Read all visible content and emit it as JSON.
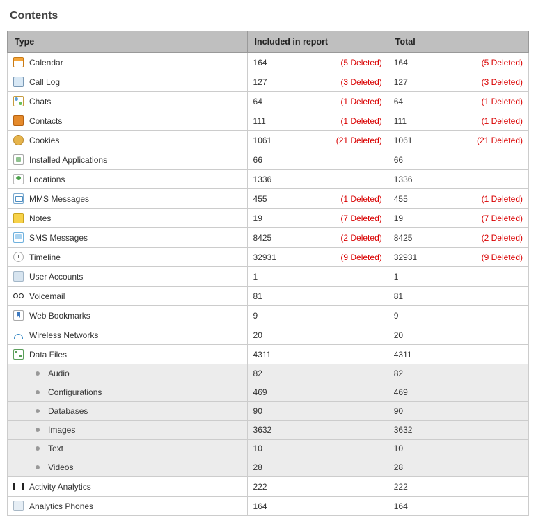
{
  "section_title": "Contents",
  "columns": {
    "type": "Type",
    "included": "Included in report",
    "total": "Total"
  },
  "deleted_fmt_prefix": "(",
  "deleted_fmt_suffix": " Deleted)",
  "rows": [
    {
      "icon": "calendar-icon",
      "css": "ic-calendar",
      "label": "Calendar",
      "included": "164",
      "inc_deleted": "5",
      "total": "164",
      "tot_deleted": "5"
    },
    {
      "icon": "call-log-icon",
      "css": "ic-calllog",
      "label": "Call Log",
      "included": "127",
      "inc_deleted": "3",
      "total": "127",
      "tot_deleted": "3"
    },
    {
      "icon": "chats-icon",
      "css": "ic-chats",
      "label": "Chats",
      "included": "64",
      "inc_deleted": "1",
      "total": "64",
      "tot_deleted": "1"
    },
    {
      "icon": "contacts-icon",
      "css": "ic-contacts",
      "label": "Contacts",
      "included": "111",
      "inc_deleted": "1",
      "total": "111",
      "tot_deleted": "1"
    },
    {
      "icon": "cookies-icon",
      "css": "ic-cookies",
      "label": "Cookies",
      "included": "1061",
      "inc_deleted": "21",
      "total": "1061",
      "tot_deleted": "21"
    },
    {
      "icon": "installed-apps-icon",
      "css": "ic-apps",
      "label": "Installed Applications",
      "included": "66",
      "inc_deleted": null,
      "total": "66",
      "tot_deleted": null
    },
    {
      "icon": "locations-icon",
      "css": "ic-locations",
      "label": "Locations",
      "included": "1336",
      "inc_deleted": null,
      "total": "1336",
      "tot_deleted": null
    },
    {
      "icon": "mms-icon",
      "css": "ic-mms",
      "label": "MMS Messages",
      "included": "455",
      "inc_deleted": "1",
      "total": "455",
      "tot_deleted": "1"
    },
    {
      "icon": "notes-icon",
      "css": "ic-notes",
      "label": "Notes",
      "included": "19",
      "inc_deleted": "7",
      "total": "19",
      "tot_deleted": "7"
    },
    {
      "icon": "sms-icon",
      "css": "ic-sms",
      "label": "SMS Messages",
      "included": "8425",
      "inc_deleted": "2",
      "total": "8425",
      "tot_deleted": "2"
    },
    {
      "icon": "timeline-icon",
      "css": "ic-timeline",
      "label": "Timeline",
      "included": "32931",
      "inc_deleted": "9",
      "total": "32931",
      "tot_deleted": "9"
    },
    {
      "icon": "user-accounts-icon",
      "css": "ic-useracc",
      "label": "User Accounts",
      "included": "1",
      "inc_deleted": null,
      "total": "1",
      "tot_deleted": null
    },
    {
      "icon": "voicemail-icon",
      "css": "ic-voicemail",
      "label": "Voicemail",
      "included": "81",
      "inc_deleted": null,
      "total": "81",
      "tot_deleted": null
    },
    {
      "icon": "web-bookmarks-icon",
      "css": "ic-bookmark",
      "label": "Web Bookmarks",
      "included": "9",
      "inc_deleted": null,
      "total": "9",
      "tot_deleted": null
    },
    {
      "icon": "wireless-networks-icon",
      "css": "ic-wifi",
      "label": "Wireless Networks",
      "included": "20",
      "inc_deleted": null,
      "total": "20",
      "tot_deleted": null
    },
    {
      "icon": "data-files-icon",
      "css": "ic-datafile",
      "label": "Data Files",
      "included": "4311",
      "inc_deleted": null,
      "total": "4311",
      "tot_deleted": null
    },
    {
      "sub": true,
      "label": "Audio",
      "included": "82",
      "inc_deleted": null,
      "total": "82",
      "tot_deleted": null
    },
    {
      "sub": true,
      "label": "Configurations",
      "included": "469",
      "inc_deleted": null,
      "total": "469",
      "tot_deleted": null
    },
    {
      "sub": true,
      "label": "Databases",
      "included": "90",
      "inc_deleted": null,
      "total": "90",
      "tot_deleted": null
    },
    {
      "sub": true,
      "label": "Images",
      "included": "3632",
      "inc_deleted": null,
      "total": "3632",
      "tot_deleted": null
    },
    {
      "sub": true,
      "label": "Text",
      "included": "10",
      "inc_deleted": null,
      "total": "10",
      "tot_deleted": null
    },
    {
      "sub": true,
      "label": "Videos",
      "included": "28",
      "inc_deleted": null,
      "total": "28",
      "tot_deleted": null
    },
    {
      "icon": "activity-analytics-icon",
      "css": "ic-activity",
      "label": "Activity Analytics",
      "included": "222",
      "inc_deleted": null,
      "total": "222",
      "tot_deleted": null
    },
    {
      "icon": "analytics-phones-icon",
      "css": "ic-aphones",
      "label": "Analytics Phones",
      "included": "164",
      "inc_deleted": null,
      "total": "164",
      "tot_deleted": null
    }
  ]
}
